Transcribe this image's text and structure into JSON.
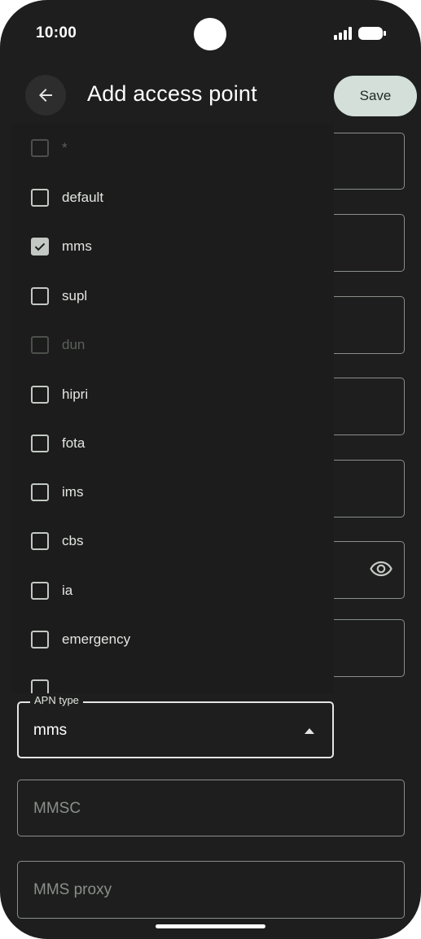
{
  "status_bar": {
    "time": "10:00"
  },
  "app_bar": {
    "title": "Add access point",
    "save_label": "Save"
  },
  "menu": {
    "items": [
      {
        "label": "*",
        "checked": false,
        "enabled": false
      },
      {
        "label": "default",
        "checked": false,
        "enabled": true
      },
      {
        "label": "mms",
        "checked": true,
        "enabled": true
      },
      {
        "label": "supl",
        "checked": false,
        "enabled": true
      },
      {
        "label": "dun",
        "checked": false,
        "enabled": false
      },
      {
        "label": "hipri",
        "checked": false,
        "enabled": true
      },
      {
        "label": "fota",
        "checked": false,
        "enabled": true
      },
      {
        "label": "ims",
        "checked": false,
        "enabled": true
      },
      {
        "label": "cbs",
        "checked": false,
        "enabled": true
      },
      {
        "label": "ia",
        "checked": false,
        "enabled": true
      },
      {
        "label": "emergency",
        "checked": false,
        "enabled": true
      }
    ]
  },
  "apn_type": {
    "label": "APN type",
    "value": "mms"
  },
  "fields": {
    "mmsc_placeholder": "MMSC",
    "mms_proxy_placeholder": "MMS proxy"
  },
  "colors": {
    "background": "#1d1e1d",
    "save_button": "#d3dfd8",
    "checkbox": "#c4c8c4"
  }
}
